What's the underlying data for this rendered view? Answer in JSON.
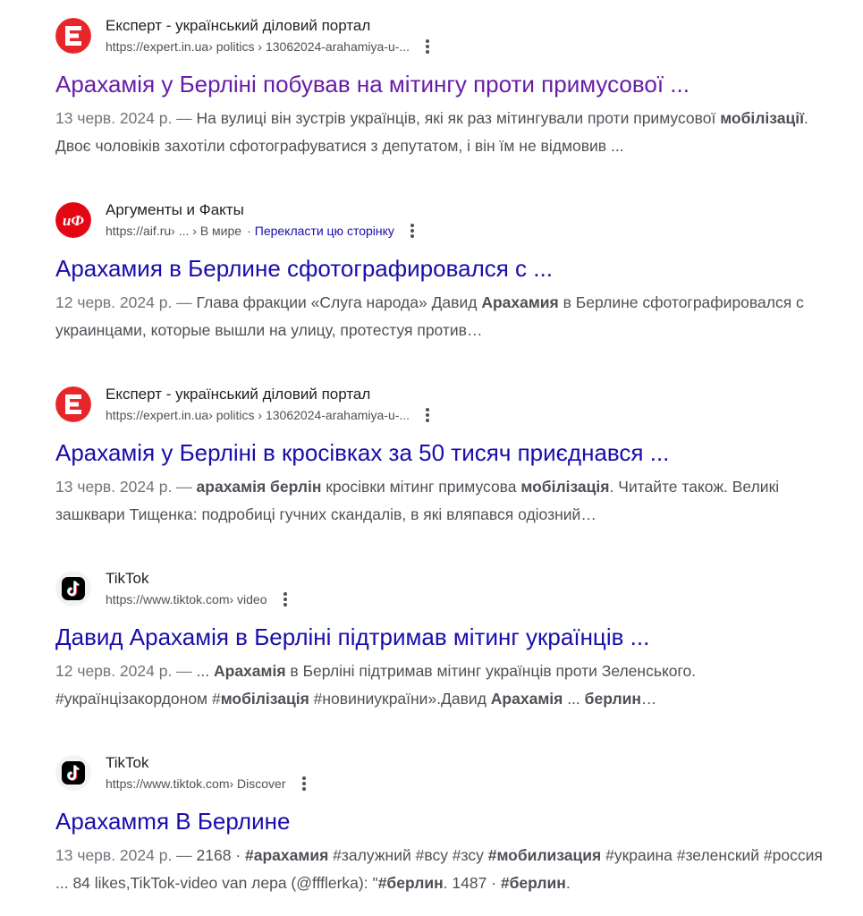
{
  "results": [
    {
      "site_name": "Експерт - український діловий портал",
      "url_base": "https://expert.in.ua",
      "url_path": " › politics › 13062024-arahamiya-u-...",
      "translate": "",
      "title": "Арахамія у Берліні побував на мітингу проти примусової ...",
      "date": "13 черв. 2024 р. — ",
      "snippet_parts": [
        {
          "text": "На вулиці він зустрів українців, які як раз мітингували проти примусової ",
          "bold": false
        },
        {
          "text": "мобілізації",
          "bold": true
        },
        {
          "text": ". Двоє чоловіків захотіли сфотографуватися з депутатом, і він їм не відмовив ...",
          "bold": false
        }
      ],
      "favicon": "expert-e-icon",
      "visited": true
    },
    {
      "site_name": "Аргументы и Факты",
      "url_base": "https://aif.ru",
      "url_path": " › ... › В мире",
      "translate": "Перекласти цю сторінку",
      "title": "Арахамия в Берлине сфотографировался с ...",
      "date": "12 черв. 2024 р. — ",
      "snippet_parts": [
        {
          "text": "Глава фракции «Слуга народа» Давид ",
          "bold": false
        },
        {
          "text": "Арахамия",
          "bold": true
        },
        {
          "text": " в Берлине сфотографировался с украинцами, которые вышли на улицу, протестуя против…",
          "bold": false
        }
      ],
      "favicon": "aif-logo-icon",
      "visited": false
    },
    {
      "site_name": "Експерт - український діловий портал",
      "url_base": "https://expert.in.ua",
      "url_path": " › politics › 13062024-arahamiya-u-...",
      "translate": "",
      "title": "Арахамія у Берліні в кросівках за 50 тисяч приєднався ...",
      "date": "13 черв. 2024 р. — ",
      "snippet_parts": [
        {
          "text": "арахамія берлін",
          "bold": true
        },
        {
          "text": " кросівки мітинг примусова ",
          "bold": false
        },
        {
          "text": "мобілізація",
          "bold": true
        },
        {
          "text": ". Читайте також. Великі зашквари Тищенка: подробиці гучних скандалів, в які вляпався одіозний…",
          "bold": false
        }
      ],
      "favicon": "expert-e-icon",
      "visited": false
    },
    {
      "site_name": "TikTok",
      "url_base": "https://www.tiktok.com",
      "url_path": " › video",
      "translate": "",
      "title": "Давид Арахамія в Берліні підтримав мітинг українців ...",
      "date": "12 черв. 2024 р. — ",
      "snippet_parts": [
        {
          "text": "... ",
          "bold": false
        },
        {
          "text": "Арахамія",
          "bold": true
        },
        {
          "text": " в Берліні підтримав мітинг українців проти Зеленського. #українцізакордоном #",
          "bold": false
        },
        {
          "text": "мобілізація",
          "bold": true
        },
        {
          "text": " #новиниукраїни».Давид ",
          "bold": false
        },
        {
          "text": "Арахамія",
          "bold": true
        },
        {
          "text": " ... ",
          "bold": false
        },
        {
          "text": "берлин",
          "bold": true
        },
        {
          "text": "…",
          "bold": false
        }
      ],
      "favicon": "tiktok-icon",
      "visited": false
    },
    {
      "site_name": "TikTok",
      "url_base": "https://www.tiktok.com",
      "url_path": " › Discover",
      "translate": "",
      "title": "Арахамmя В Берлине",
      "date": "13 черв. 2024 р. — ",
      "snippet_parts": [
        {
          "text": "2168 · ",
          "bold": false
        },
        {
          "text": "#арахамия",
          "bold": true
        },
        {
          "text": " #залужний #всу #зсу ",
          "bold": false
        },
        {
          "text": "#мобилизация",
          "bold": true
        },
        {
          "text": " #украина #зеленский #россия ... 84 likes,TikTok-video van лера (@ffflerka): \"",
          "bold": false
        },
        {
          "text": "#берлин",
          "bold": true
        },
        {
          "text": ". 1487 · ",
          "bold": false
        },
        {
          "text": "#берлин",
          "bold": true
        },
        {
          "text": ".",
          "bold": false
        }
      ],
      "favicon": "tiktok-icon",
      "visited": false
    }
  ],
  "colors": {
    "link": "#1a0dab",
    "visited_link": "#681da8",
    "snippet_text": "#4d5156",
    "expert_red": "#e8262a",
    "aif_red": "#e30613",
    "tiktok_bg": "#000000"
  }
}
